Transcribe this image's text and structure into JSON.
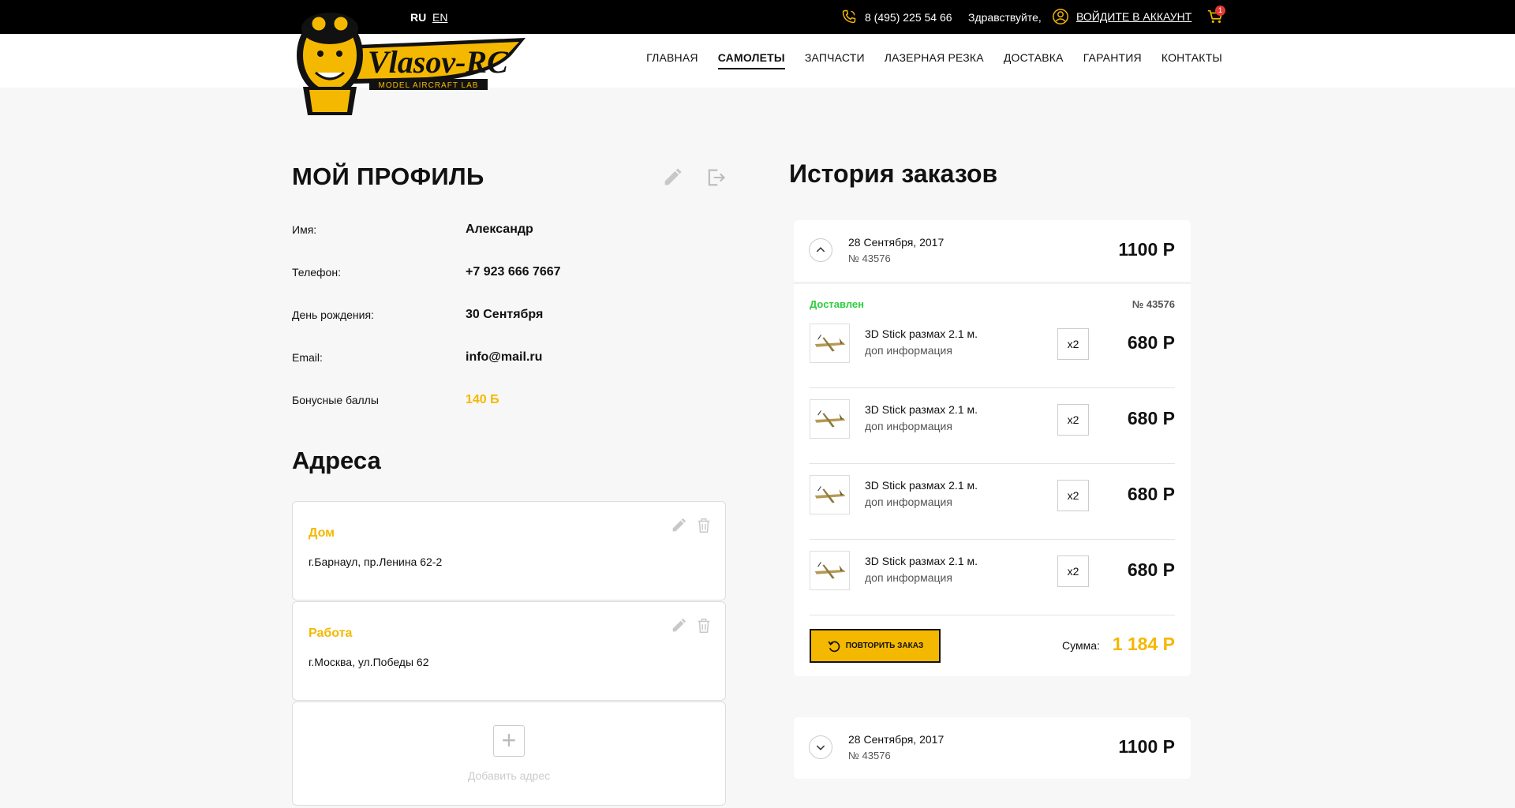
{
  "header": {
    "lang_ru": "RU",
    "lang_en": "EN",
    "phone": "8 (495) 225 54 66",
    "greeting": "Здравствуйте,",
    "login": "ВОЙДИТЕ В АККАУНТ",
    "cart_count": "1"
  },
  "logo": {
    "brand": "Vlasov-RC",
    "tagline": "MODEL AIRCRAFT LAB"
  },
  "nav": [
    "ГЛАВНАЯ",
    "САМОЛЕТЫ",
    "ЗАПЧАСТИ",
    "ЛАЗЕРНАЯ РЕЗКА",
    "ДОСТАВКА",
    "ГАРАНТИЯ",
    "КОНТАКТЫ"
  ],
  "nav_active": "САМОЛЕТЫ",
  "profile": {
    "title": "МОЙ ПРОФИЛЬ",
    "fields": [
      {
        "label": "Имя:",
        "value": "Александр"
      },
      {
        "label": "Телефон:",
        "value": "+7 923 666 7667"
      },
      {
        "label": "День рождения:",
        "value": "30 Сентября"
      },
      {
        "label": "Email:",
        "value": "info@mail.ru"
      },
      {
        "label": "Бонусные баллы",
        "value": "140 Б"
      }
    ]
  },
  "addresses": {
    "title": "Адреса",
    "items": [
      {
        "name": "Дом",
        "address": "г.Барнаул, пр.Ленина 62-2"
      },
      {
        "name": "Работа",
        "address": "г.Москва, ул.Победы 62"
      }
    ],
    "add_label": "Добавить адрес"
  },
  "orders": {
    "title": "История заказов",
    "list": [
      {
        "date": "28 Сентября, 2017",
        "number": "№ 43576",
        "total": "1100 Р",
        "status": "Доставлен",
        "status_number": "№ 43576",
        "items": [
          {
            "name": "3D Stick размах 2.1 м.",
            "info": "доп информация",
            "qty": "x2",
            "price": "680 Р"
          },
          {
            "name": "3D Stick размах 2.1 м.",
            "info": "доп информация",
            "qty": "x2",
            "price": "680 Р"
          },
          {
            "name": "3D Stick размах 2.1 м.",
            "info": "доп информация",
            "qty": "x2",
            "price": "680 Р"
          },
          {
            "name": "3D Stick размах 2.1 м.",
            "info": "доп информация",
            "qty": "x2",
            "price": "680 Р"
          }
        ],
        "repeat_label": "ПОВТОРИТЬ ЗАКАЗ",
        "sum_label": "Сумма:",
        "sum_value": "1 184 Р"
      },
      {
        "date": "28 Сентября, 2017",
        "number": "№ 43576",
        "total": "1100 Р"
      }
    ]
  },
  "colors": {
    "accent": "#f5b800",
    "status_green": "#2ecc40",
    "topbar": "#000000"
  }
}
